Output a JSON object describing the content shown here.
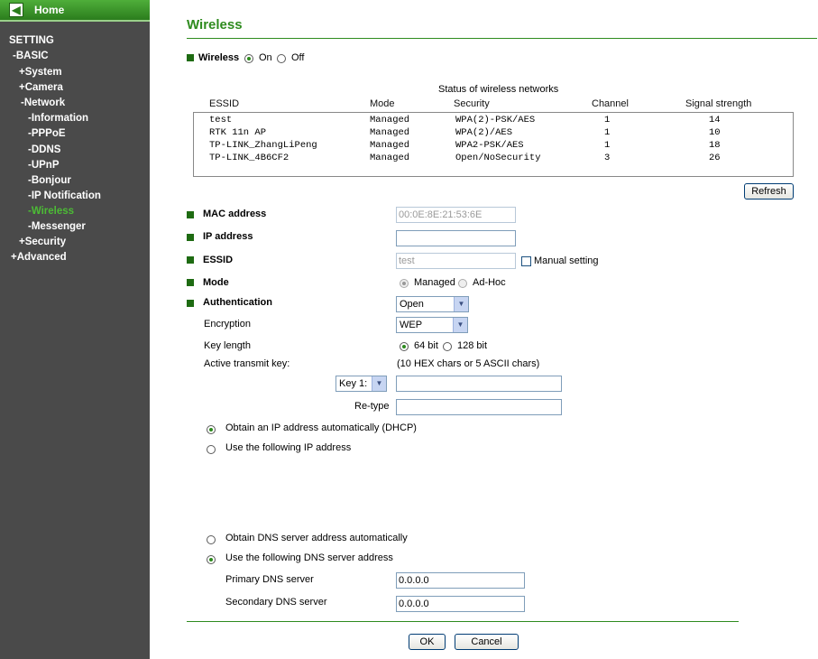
{
  "sidebar": {
    "home_label": "Home",
    "setting": "SETTING",
    "items": [
      {
        "label": "-BASIC"
      },
      {
        "label": "+System"
      },
      {
        "label": "+Camera"
      },
      {
        "label": "-Network"
      },
      {
        "label": "-Information"
      },
      {
        "label": "-PPPoE"
      },
      {
        "label": "-DDNS"
      },
      {
        "label": "-UPnP"
      },
      {
        "label": "-Bonjour"
      },
      {
        "label": "-IP Notification"
      },
      {
        "label": "-Wireless"
      },
      {
        "label": "-Messenger"
      },
      {
        "label": "+Security"
      },
      {
        "label": "+Advanced"
      }
    ]
  },
  "page_title": "Wireless",
  "wireless": {
    "label": "Wireless",
    "on": "On",
    "off": "Off"
  },
  "status": {
    "title": "Status of wireless networks",
    "headers": {
      "essid": "ESSID",
      "mode": "Mode",
      "security": "Security",
      "channel": "Channel",
      "signal": "Signal strength"
    },
    "rows": [
      {
        "essid": "test",
        "mode": "Managed",
        "security": "WPA(2)-PSK/AES",
        "channel": "1",
        "signal": "14"
      },
      {
        "essid": "RTK 11n AP",
        "mode": "Managed",
        "security": "WPA(2)/AES",
        "channel": "1",
        "signal": "10"
      },
      {
        "essid": "TP-LINK_ZhangLiPeng",
        "mode": "Managed",
        "security": "WPA2-PSK/AES",
        "channel": "1",
        "signal": "18"
      },
      {
        "essid": "TP-LINK_4B6CF2",
        "mode": "Managed",
        "security": "Open/NoSecurity",
        "channel": "3",
        "signal": "26"
      }
    ],
    "refresh": "Refresh"
  },
  "form": {
    "mac_label": "MAC address",
    "mac_value": "00:0E:8E:21:53:6E",
    "ip_label": "IP address",
    "ip_value": "",
    "essid_label": "ESSID",
    "essid_value": "test",
    "manual_setting": "Manual setting",
    "mode_label": "Mode",
    "mode_managed": "Managed",
    "mode_adhoc": "Ad-Hoc",
    "auth_label": "Authentication",
    "auth_value": "Open",
    "enc_label": "Encryption",
    "enc_value": "WEP",
    "keylen_label": "Key length",
    "keylen_64": "64 bit",
    "keylen_128": "128 bit",
    "active_key_label": "Active transmit key:",
    "key_hint": "(10 HEX chars or 5 ASCII chars)",
    "key_select": "Key 1:",
    "retype_label": "Re-type",
    "dhcp_auto": "Obtain an IP address automatically (DHCP)",
    "ip_manual": "Use the following IP address",
    "dns_auto": "Obtain DNS server address automatically",
    "dns_manual": "Use the following DNS server address",
    "primary_dns_label": "Primary DNS server",
    "primary_dns_value": "0.0.0.0",
    "secondary_dns_label": "Secondary DNS server",
    "secondary_dns_value": "0.0.0.0"
  },
  "buttons": {
    "ok": "OK",
    "cancel": "Cancel"
  }
}
